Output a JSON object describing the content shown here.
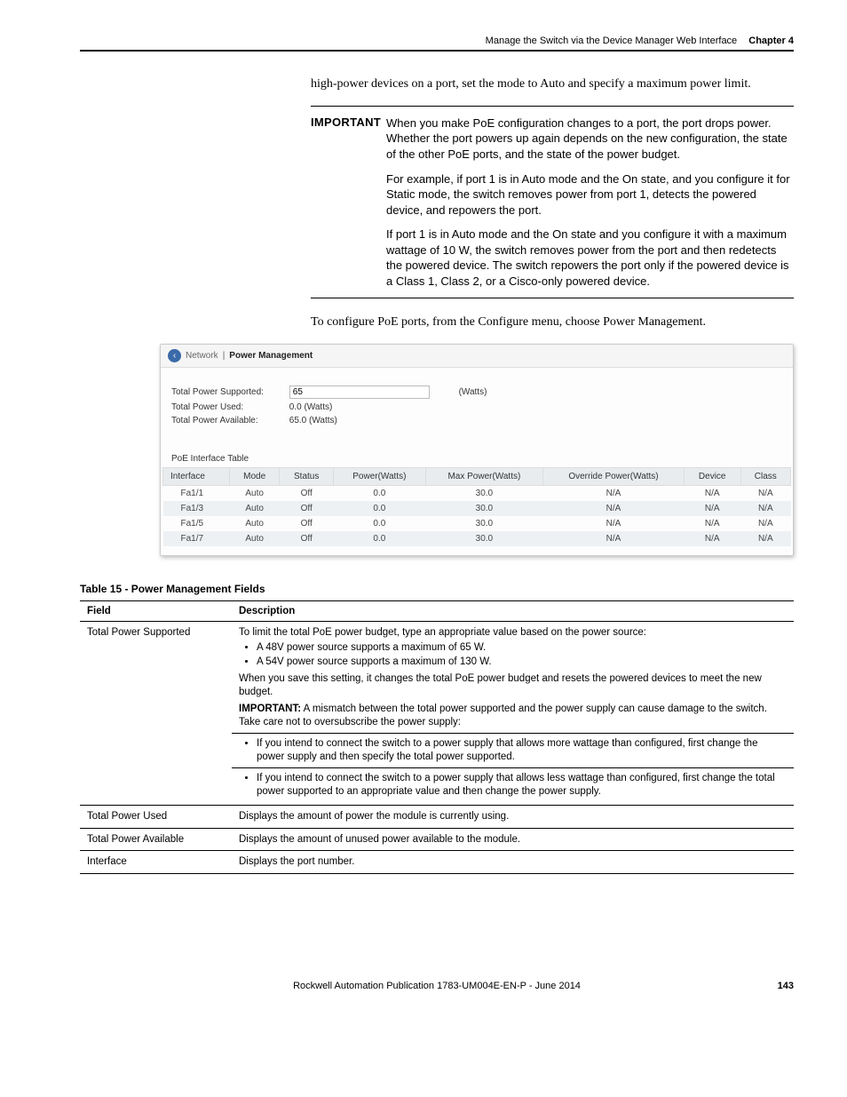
{
  "header": {
    "section_title": "Manage the Switch via the Device Manager Web Interface",
    "chapter_label": "Chapter 4"
  },
  "intro_para": "high-power devices on a port, set the mode to Auto and specify a maximum power limit.",
  "important": {
    "label": "IMPORTANT",
    "p1": "When you make PoE configuration changes to a port, the port drops power. Whether the port powers up again depends on the new configuration, the state of the other PoE ports, and the state of the power budget.",
    "p2": "For example, if port 1 is in Auto mode and the On state, and you configure it for Static mode, the switch removes power from port 1, detects the powered device, and repowers the port.",
    "p3": "If port 1 is in Auto mode and the On state and you configure it with a maximum wattage of 10 W, the switch removes power from the port and then redetects the powered device. The switch repowers the port only if the powered device is a Class 1, Class 2, or a Cisco-only powered device."
  },
  "config_para": "To configure PoE ports, from the Configure menu, choose Power Management.",
  "screenshot": {
    "breadcrumb_a": "Network",
    "breadcrumb_sep": "|",
    "breadcrumb_b": "Power Management",
    "total_power_supported_label": "Total Power Supported:",
    "total_power_supported_value": "65",
    "total_power_supported_unit": "(Watts)",
    "total_power_used_label": "Total Power Used:",
    "total_power_used_value": "0.0 (Watts)",
    "total_power_available_label": "Total Power Available:",
    "total_power_available_value": "65.0 (Watts)",
    "subhead": "PoE Interface Table",
    "cols": {
      "c1": "Interface",
      "c2": "Mode",
      "c3": "Status",
      "c4": "Power(Watts)",
      "c5": "Max Power(Watts)",
      "c6": "Override Power(Watts)",
      "c7": "Device",
      "c8": "Class"
    },
    "rows": [
      {
        "iface": "Fa1/1",
        "mode": "Auto",
        "status": "Off",
        "power": "0.0",
        "max": "30.0",
        "ovr": "N/A",
        "dev": "N/A",
        "cls": "N/A"
      },
      {
        "iface": "Fa1/3",
        "mode": "Auto",
        "status": "Off",
        "power": "0.0",
        "max": "30.0",
        "ovr": "N/A",
        "dev": "N/A",
        "cls": "N/A"
      },
      {
        "iface": "Fa1/5",
        "mode": "Auto",
        "status": "Off",
        "power": "0.0",
        "max": "30.0",
        "ovr": "N/A",
        "dev": "N/A",
        "cls": "N/A"
      },
      {
        "iface": "Fa1/7",
        "mode": "Auto",
        "status": "Off",
        "power": "0.0",
        "max": "30.0",
        "ovr": "N/A",
        "dev": "N/A",
        "cls": "N/A"
      }
    ]
  },
  "table15": {
    "caption": "Table 15 - Power Management Fields",
    "head_field": "Field",
    "head_desc": "Description",
    "row1_field": "Total Power Supported",
    "row1_p1": "To limit the total PoE power budget, type an appropriate value based on the power source:",
    "row1_li1": "A 48V power source supports a maximum of 65 W.",
    "row1_li2": "A 54V power source supports a maximum of 130 W.",
    "row1_p2": "When you save this setting, it changes the total PoE power budget and resets the powered devices to meet the new budget.",
    "row1_imp_label": "IMPORTANT:",
    "row1_imp_text": " A mismatch between the total power supported and the power supply can cause damage to the switch. Take care not to oversubscribe the power supply:",
    "row1_li3": "If you intend to connect the switch to a power supply that allows more wattage than configured, first change the power supply and then specify the total power supported.",
    "row1_li4": "If you intend to connect the switch to a power supply that allows less wattage than configured, first change the total power supported to an appropriate value and then change the power supply.",
    "row2_field": "Total Power Used",
    "row2_desc": "Displays the amount of power the module is currently using.",
    "row3_field": "Total Power Available",
    "row3_desc": "Displays the amount of unused power available to the module.",
    "row4_field": "Interface",
    "row4_desc": "Displays the port number."
  },
  "footer": {
    "pub": "Rockwell Automation Publication 1783-UM004E-EN-P - June 2014",
    "page": "143"
  }
}
